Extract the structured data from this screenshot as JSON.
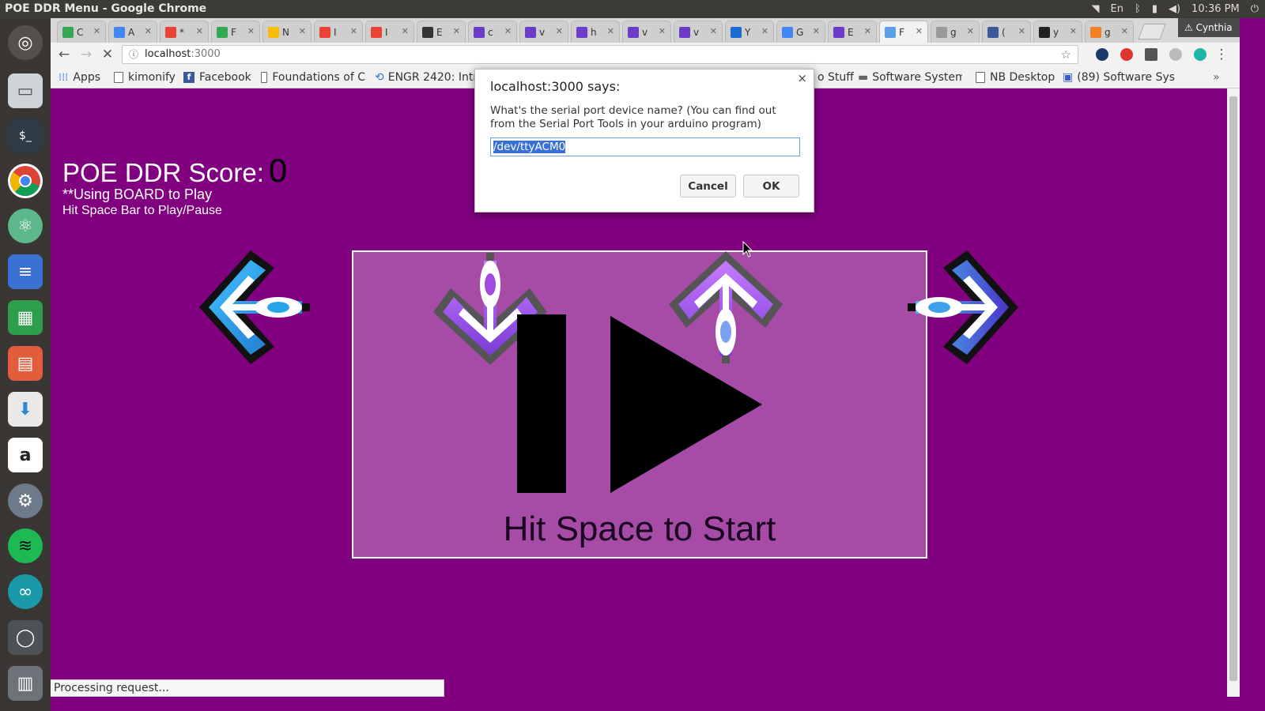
{
  "window": {
    "title": "POE DDR Menu - Google Chrome"
  },
  "systray": {
    "lang": "En",
    "time": "10:36 PM"
  },
  "tabs": [
    {
      "label": "C",
      "color": "#34a853"
    },
    {
      "label": "A",
      "color": "#4285f4"
    },
    {
      "label": "*",
      "color": "#ea4335"
    },
    {
      "label": "F",
      "color": "#34a853"
    },
    {
      "label": "N",
      "color": "#fbbc04"
    },
    {
      "label": "I",
      "color": "#ea4335"
    },
    {
      "label": "I",
      "color": "#ea4335"
    },
    {
      "label": "E",
      "color": "#333333"
    },
    {
      "label": "c",
      "color": "#6a3cc7"
    },
    {
      "label": "v",
      "color": "#6a3cc7"
    },
    {
      "label": "h",
      "color": "#6a3cc7"
    },
    {
      "label": "v",
      "color": "#6a3cc7"
    },
    {
      "label": "v",
      "color": "#6a3cc7"
    },
    {
      "label": "Y",
      "color": "#1c6bd1"
    },
    {
      "label": "G",
      "color": "#4285f4"
    },
    {
      "label": "E",
      "color": "#6a3cc7"
    },
    {
      "label": "F",
      "color": "#5aa0e8"
    },
    {
      "label": "g",
      "color": "#999999"
    },
    {
      "label": "(",
      "color": "#3b5998"
    },
    {
      "label": "y",
      "color": "#222222"
    },
    {
      "label": "g",
      "color": "#f48024"
    }
  ],
  "profile": {
    "name": "Cynthia"
  },
  "address": {
    "host": "localhost",
    "port": ":3000"
  },
  "bookmarks": [
    {
      "label": "Apps"
    },
    {
      "label": "kimonify"
    },
    {
      "label": "Facebook"
    },
    {
      "label": "Foundations of C"
    },
    {
      "label": "ENGR 2420: Intr"
    },
    {
      "label": "o Stuff"
    },
    {
      "label": "Software System"
    },
    {
      "label": "NB Desktop"
    },
    {
      "label": "(89) Software Sys"
    }
  ],
  "game": {
    "score_label": "POE DDR Score:",
    "score_value": "0",
    "board_note": "**Using BOARD to Play",
    "space_note": "Hit Space Bar to Play/Pause",
    "start_text": "Hit Space to Start"
  },
  "dialog": {
    "title": "localhost:3000 says:",
    "message": "What's the serial port device name? (You can find out from the Serial Port Tools in your arduino program)",
    "input_value": "/dev/ttyACM0",
    "cancel_label": "Cancel",
    "ok_label": "OK"
  },
  "status": {
    "text": "Processing request..."
  },
  "colors": {
    "page_bg": "#800080",
    "game_box": "#a64ca6",
    "arrow_blue": "#1a9be0",
    "arrow_purple": "#9b4ae0"
  }
}
